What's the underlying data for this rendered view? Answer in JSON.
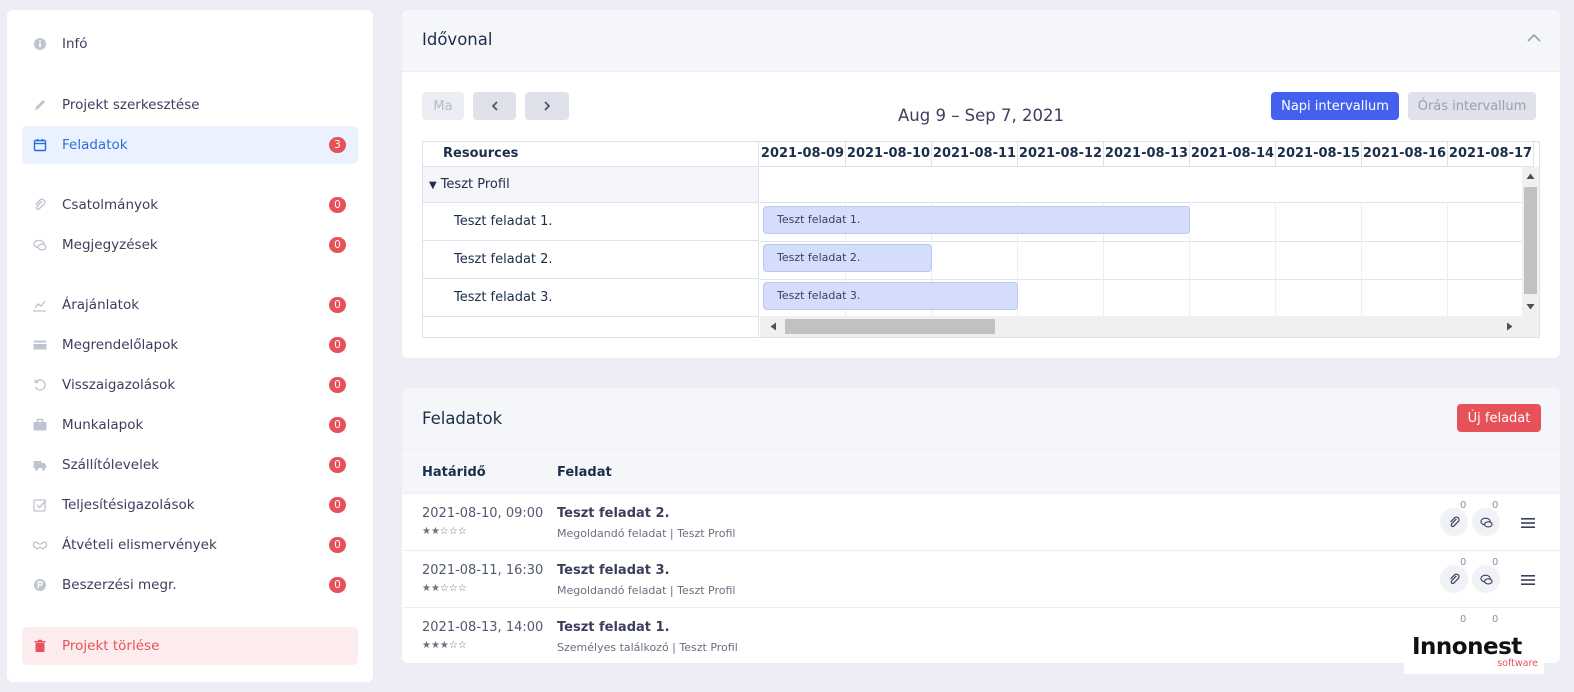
{
  "sidebar": {
    "items": [
      {
        "label": "Infó",
        "icon": "info-icon"
      },
      {
        "label": "Projekt szerkesztése",
        "icon": "pencil-icon"
      },
      {
        "label": "Feladatok",
        "icon": "calendar-icon",
        "badge": "3"
      },
      {
        "label": "Csatolmányok",
        "icon": "paperclip-icon",
        "badge": "0"
      },
      {
        "label": "Megjegyzések",
        "icon": "chat-icon",
        "badge": "0"
      },
      {
        "label": "Árajánlatok",
        "icon": "chart-line-icon",
        "badge": "0"
      },
      {
        "label": "Megrendelőlapok",
        "icon": "card-icon",
        "badge": "0"
      },
      {
        "label": "Visszaigazolások",
        "icon": "undo-icon",
        "badge": "0"
      },
      {
        "label": "Munkalapok",
        "icon": "briefcase-icon",
        "badge": "0"
      },
      {
        "label": "Szállítólevelek",
        "icon": "truck-icon",
        "badge": "0"
      },
      {
        "label": "Teljesítésigazolások",
        "icon": "check-square-icon",
        "badge": "0"
      },
      {
        "label": "Átvételi elismervények",
        "icon": "handshake-icon",
        "badge": "0"
      },
      {
        "label": "Beszerzési megr.",
        "icon": "p-circle-icon",
        "badge": "0"
      },
      {
        "label": "Projekt törlése",
        "icon": "trash-icon"
      }
    ]
  },
  "timeline": {
    "title": "Idővonal",
    "today_label": "Ma",
    "range_title": "Aug 9 – Sep 7, 2021",
    "daily_label": "Napi intervallum",
    "hourly_label": "Órás intervallum",
    "resources_header": "Resources",
    "group": "Teszt Profil",
    "resources": [
      "Teszt feladat 1.",
      "Teszt feladat 2.",
      "Teszt feladat 3."
    ],
    "days": [
      "2021-08-09",
      "2021-08-10",
      "2021-08-11",
      "2021-08-12",
      "2021-08-13",
      "2021-08-14",
      "2021-08-15",
      "2021-08-16",
      "2021-08-17"
    ],
    "events": [
      {
        "label": "Teszt feladat 1.",
        "start": "2021-08-09",
        "end": "2021-08-13"
      },
      {
        "label": "Teszt feladat 2.",
        "start": "2021-08-09",
        "end": "2021-08-10"
      },
      {
        "label": "Teszt feladat 3.",
        "start": "2021-08-09",
        "end": "2021-08-11"
      }
    ],
    "colors": {
      "event_bg": "#d4defc",
      "primary": "#4361ee"
    }
  },
  "tasks": {
    "title": "Feladatok",
    "new_label": "Új feladat",
    "col_deadline": "Határidő",
    "col_task": "Feladat",
    "rows": [
      {
        "date": "2021-08-10, 09:00",
        "stars": "★★☆☆☆",
        "title": "Teszt feladat 2.",
        "sub": "Megoldandó feladat | Teszt Profil",
        "attachments": "0",
        "comments": "0"
      },
      {
        "date": "2021-08-11, 16:30",
        "stars": "★★☆☆☆",
        "title": "Teszt feladat 3.",
        "sub": "Megoldandó feladat | Teszt Profil",
        "attachments": "0",
        "comments": "0"
      },
      {
        "date": "2021-08-13, 14:00",
        "stars": "★★★☆☆",
        "title": "Teszt feladat 1.",
        "sub": "Személyes találkozó | Teszt Profil",
        "attachments": "0",
        "comments": "0"
      }
    ]
  },
  "logo": {
    "name": "Innonest",
    "sub": "software"
  }
}
